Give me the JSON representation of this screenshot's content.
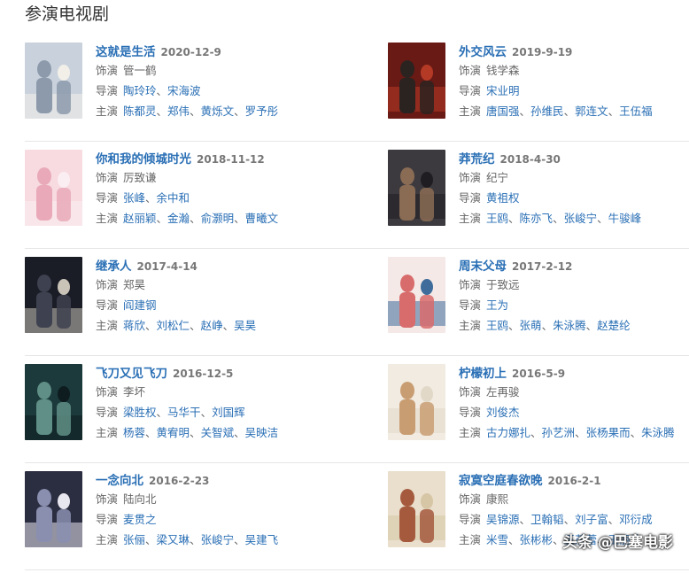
{
  "section": {
    "title": "参演电视剧"
  },
  "labels": {
    "role": "饰演",
    "director": "导演",
    "cast": "主演",
    "sep": "、"
  },
  "shows": [
    {
      "title": "这就是生活",
      "date": "2020-12-9",
      "role": "管一鹤",
      "directors": [
        "陶玲玲",
        "宋海波"
      ],
      "cast": [
        "陈都灵",
        "郑伟",
        "黄烁文",
        "罗予彤"
      ],
      "poster_colors": [
        "#c9d2dc",
        "#8c9aab",
        "#f2efe9"
      ]
    },
    {
      "title": "外交风云",
      "date": "2019-9-19",
      "role": "钱学森",
      "directors": [
        "宋业明"
      ],
      "cast": [
        "唐国强",
        "孙维民",
        "郭连文",
        "王伍福"
      ],
      "poster_colors": [
        "#6a1a15",
        "#2b2320",
        "#b43a26"
      ]
    },
    {
      "title": "你和我的倾城时光",
      "date": "2018-11-12",
      "role": "厉致谦",
      "directors": [
        "张峰",
        "余中和"
      ],
      "cast": [
        "赵丽颖",
        "金瀚",
        "俞灏明",
        "曹曦文"
      ],
      "poster_colors": [
        "#f7dbe1",
        "#e9a9b8",
        "#fbeef2"
      ]
    },
    {
      "title": "莽荒纪",
      "date": "2018-4-30",
      "role": "纪宁",
      "directors": [
        "黄祖权"
      ],
      "cast": [
        "王鸥",
        "陈亦飞",
        "张峻宁",
        "牛骏峰"
      ],
      "poster_colors": [
        "#3c3a3e",
        "#8a6c55",
        "#1f1d22"
      ]
    },
    {
      "title": "继承人",
      "date": "2017-4-14",
      "role": "郑昊",
      "directors": [
        "阎建钢"
      ],
      "cast": [
        "蒋欣",
        "刘松仁",
        "赵峥",
        "吴昊"
      ],
      "poster_colors": [
        "#1b1d26",
        "#3e4150",
        "#c9c3b8"
      ]
    },
    {
      "title": "周末父母",
      "date": "2017-2-12",
      "role": "于致远",
      "directors": [
        "王为"
      ],
      "cast": [
        "王鸥",
        "张萌",
        "朱泳腾",
        "赵楚纶"
      ],
      "poster_colors": [
        "#f4e9e6",
        "#d86b6b",
        "#3f6c9a"
      ]
    },
    {
      "title": "飞刀又见飞刀",
      "date": "2016-12-5",
      "role": "李坏",
      "directors": [
        "梁胜权",
        "马华干",
        "刘国辉"
      ],
      "cast": [
        "杨蓉",
        "黄宥明",
        "关智斌",
        "吴映洁"
      ],
      "poster_colors": [
        "#1c3a3b",
        "#5f8f86",
        "#0e1c1f"
      ]
    },
    {
      "title": "柠檬初上",
      "date": "2016-5-9",
      "role": "左再骏",
      "directors": [
        "刘俊杰"
      ],
      "cast": [
        "古力娜扎",
        "孙艺洲",
        "张杨果而",
        "朱泳腾"
      ],
      "poster_colors": [
        "#f1ebe1",
        "#c99d72",
        "#e2d8c8"
      ]
    },
    {
      "title": "一念向北",
      "date": "2016-2-23",
      "role": "陆向北",
      "directors": [
        "麦贯之"
      ],
      "cast": [
        "张俪",
        "梁又琳",
        "张峻宁",
        "吴建飞"
      ],
      "poster_colors": [
        "#2b2d40",
        "#8a8fb0",
        "#e8e6ee"
      ]
    },
    {
      "title": "寂寞空庭春欲晚",
      "date": "2016-2-1",
      "role": "康熙",
      "directors": [
        "吴锦源",
        "卫翰韬",
        "刘子富",
        "邓衍成"
      ],
      "cast": [
        "米雪",
        "张彬彬",
        "王茂蕾",
        "王丽坤"
      ],
      "poster_colors": [
        "#e9dfcc",
        "#a55a3e",
        "#d6c6a6"
      ]
    }
  ],
  "watermark": {
    "text": "头条 @巴塞电影"
  }
}
